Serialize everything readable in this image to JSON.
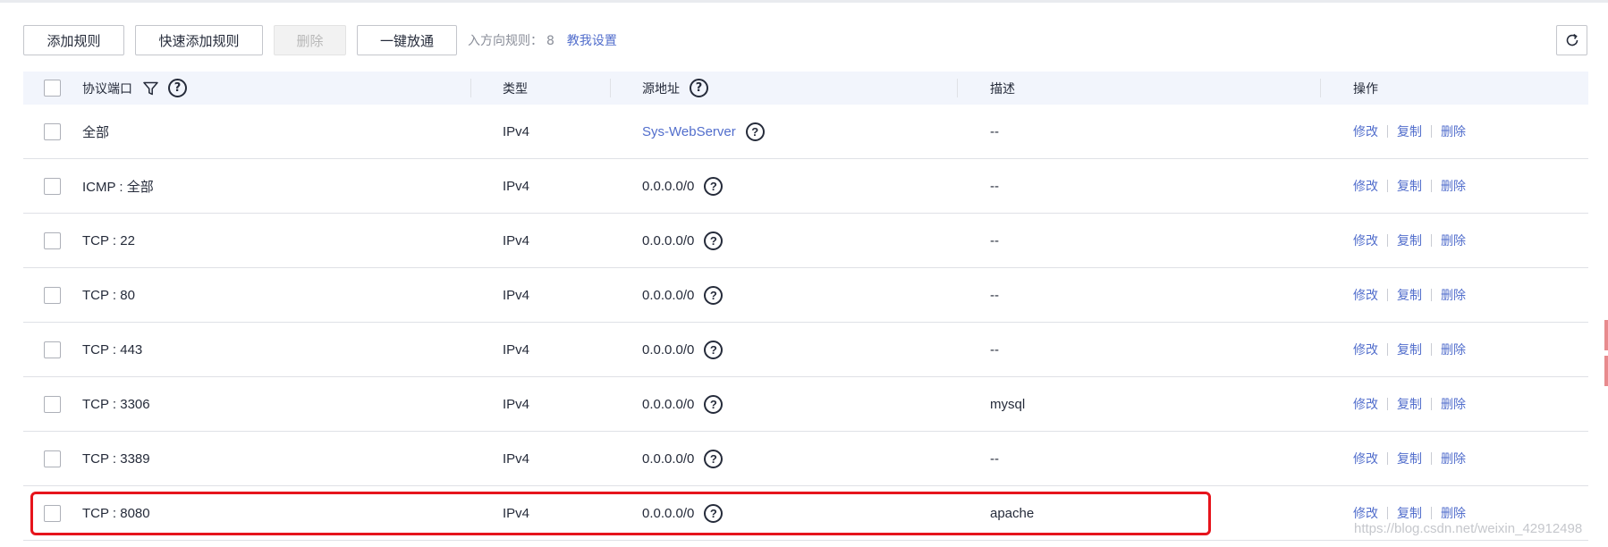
{
  "toolbar": {
    "add_rule": "添加规则",
    "quick_add_rule": "快速添加规则",
    "delete": "删除",
    "one_click_open": "一键放通",
    "inbound_label": "入方向规则：",
    "inbound_count": "8",
    "teach_link": "教我设置"
  },
  "refresh_icon": "refresh-icon",
  "table": {
    "headers": {
      "port": "协议端口",
      "type": "类型",
      "source": "源地址",
      "desc": "描述",
      "ops": "操作"
    },
    "rows": [
      {
        "port": "全部",
        "type": "IPv4",
        "source": "Sys-WebServer",
        "desc": "--",
        "edit": "修改",
        "copy": "复制",
        "delete": "删除"
      },
      {
        "port": "ICMP : 全部",
        "type": "IPv4",
        "source": "0.0.0.0/0",
        "desc": "--",
        "edit": "修改",
        "copy": "复制",
        "delete": "删除"
      },
      {
        "port": "TCP : 22",
        "type": "IPv4",
        "source": "0.0.0.0/0",
        "desc": "--",
        "edit": "修改",
        "copy": "复制",
        "delete": "删除"
      },
      {
        "port": "TCP : 80",
        "type": "IPv4",
        "source": "0.0.0.0/0",
        "desc": "--",
        "edit": "修改",
        "copy": "复制",
        "delete": "删除"
      },
      {
        "port": "TCP : 443",
        "type": "IPv4",
        "source": "0.0.0.0/0",
        "desc": "--",
        "edit": "修改",
        "copy": "复制",
        "delete": "删除"
      },
      {
        "port": "TCP : 3306",
        "type": "IPv4",
        "source": "0.0.0.0/0",
        "desc": "mysql",
        "edit": "修改",
        "copy": "复制",
        "delete": "删除"
      },
      {
        "port": "TCP : 3389",
        "type": "IPv4",
        "source": "0.0.0.0/0",
        "desc": "--",
        "edit": "修改",
        "copy": "复制",
        "delete": "删除"
      },
      {
        "port": "TCP : 8080",
        "type": "IPv4",
        "source": "0.0.0.0/0",
        "desc": "apache",
        "edit": "修改",
        "copy": "复制",
        "delete": "删除"
      }
    ]
  },
  "help_glyph": "?",
  "watermark": "https://blog.csdn.net/weixin_42912498",
  "colors": {
    "link": "#526ecc",
    "highlight": "#e6141c",
    "header_bg": "#f2f5fc"
  }
}
